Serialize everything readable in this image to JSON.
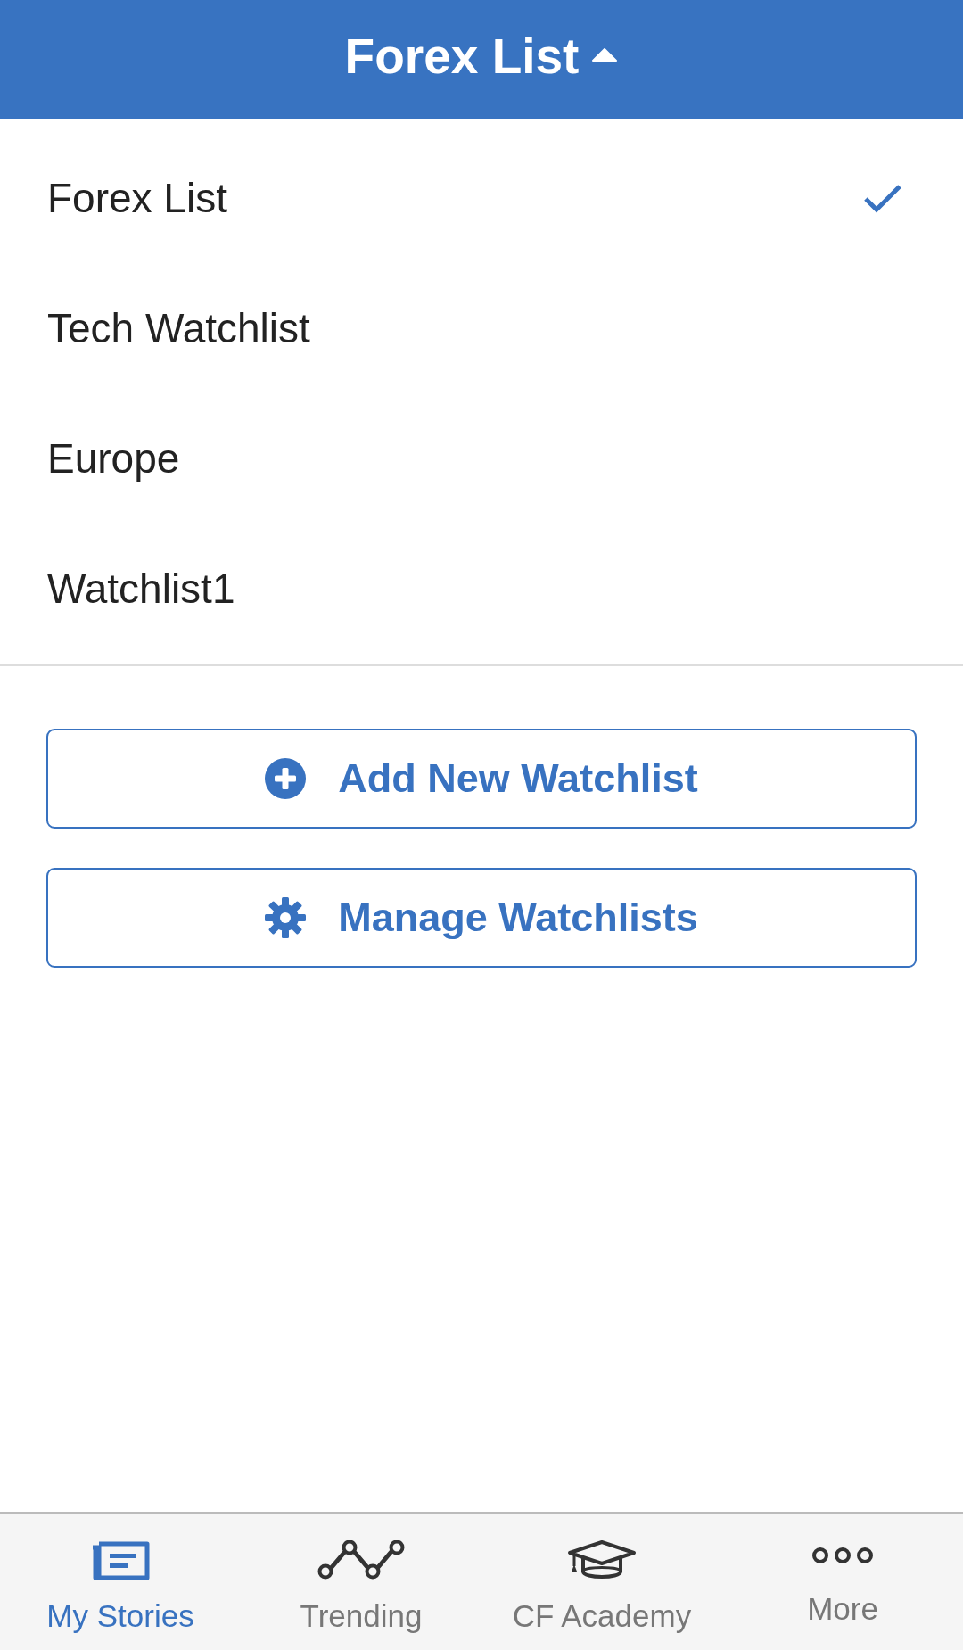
{
  "header": {
    "title": "Forex List",
    "expanded": true
  },
  "watchlists": [
    {
      "label": "Forex List",
      "selected": true
    },
    {
      "label": "Tech Watchlist",
      "selected": false
    },
    {
      "label": "Europe",
      "selected": false
    },
    {
      "label": "Watchlist1",
      "selected": false
    }
  ],
  "actions": [
    {
      "kind": "add",
      "label": "Add New Watchlist"
    },
    {
      "kind": "manage",
      "label": "Manage Watchlists"
    }
  ],
  "tab_bar": [
    {
      "kind": "stories",
      "label": "My Stories",
      "selected": true
    },
    {
      "kind": "trending",
      "label": "Trending",
      "selected": false
    },
    {
      "kind": "academy",
      "label": "CF Academy",
      "selected": false
    },
    {
      "kind": "more",
      "label": "More",
      "selected": false
    }
  ]
}
